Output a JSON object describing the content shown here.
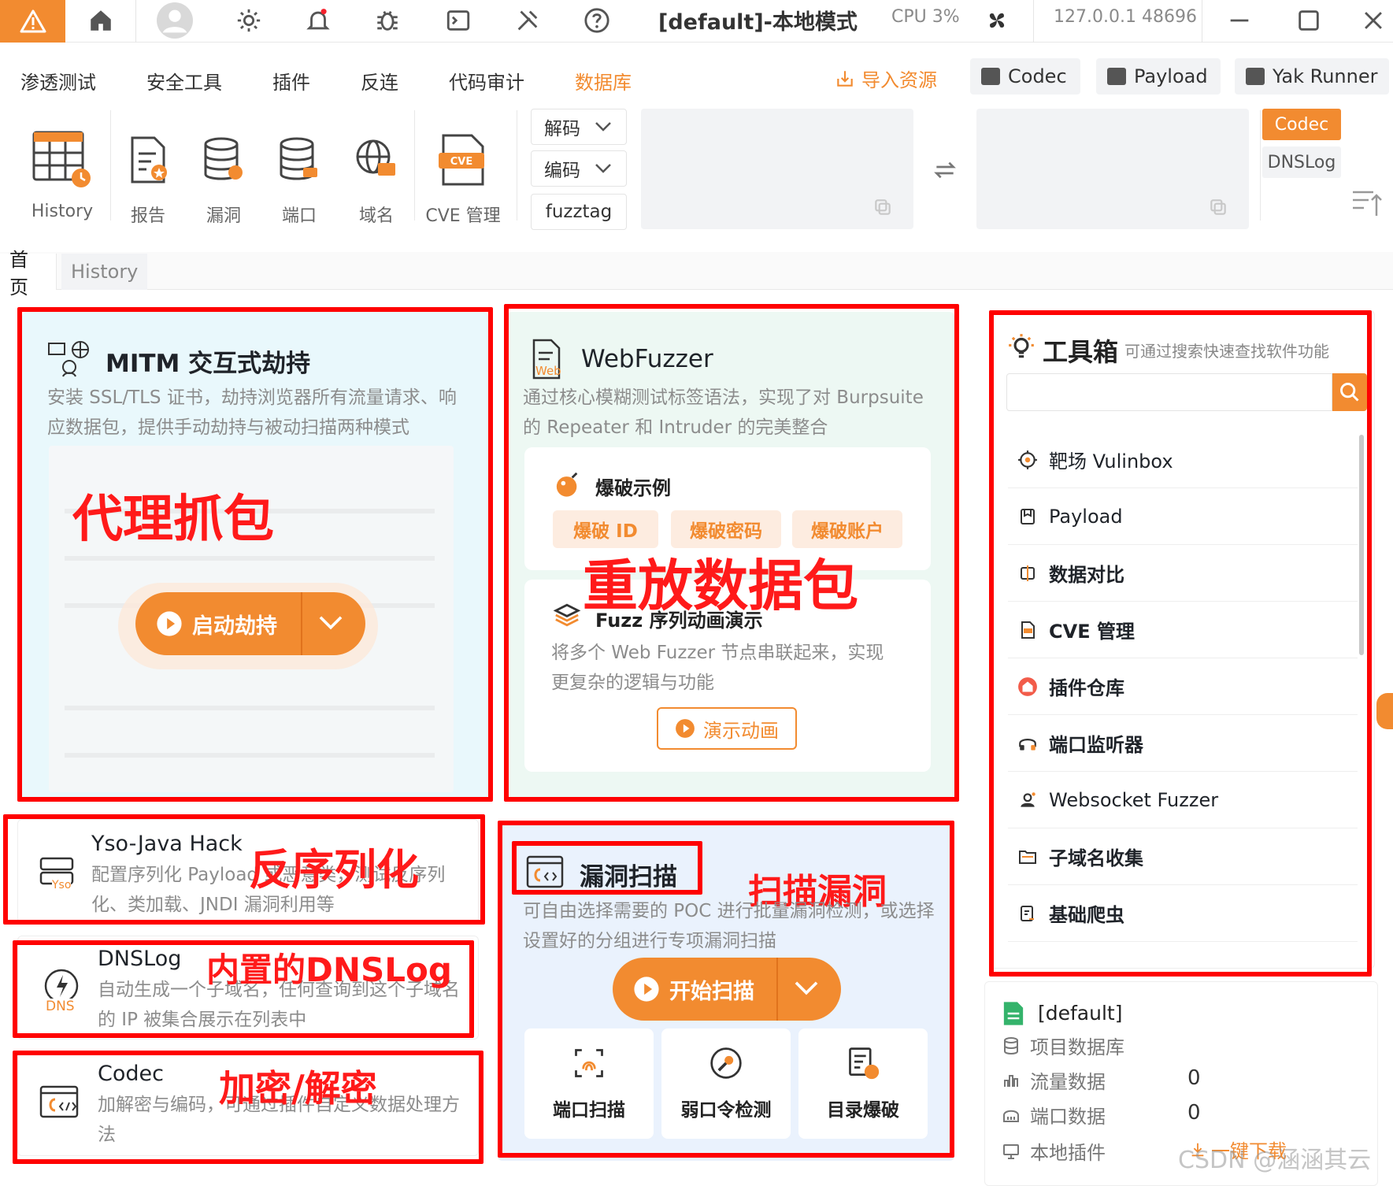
{
  "titlebar": {
    "mode_title": "[default]-本地模式",
    "cpu": "CPU 3%",
    "host": "127.0.0.1 48696",
    "icons": [
      "yak-logo",
      "home-icon",
      "user-avatar-icon",
      "settings-icon",
      "bell-icon",
      "bug-icon",
      "terminal-icon",
      "tools-icon",
      "help-icon",
      "engine-status-icon",
      "minimize-icon",
      "maximize-icon",
      "close-icon"
    ]
  },
  "menu": {
    "items": [
      "渗透测试",
      "安全工具",
      "插件",
      "反连",
      "代码审计",
      "数据库"
    ],
    "active": "数据库",
    "import_label": "导入资源",
    "buttons": [
      "Codec",
      "Payload",
      "Yak Runner"
    ]
  },
  "toolbar": {
    "tools": [
      "History",
      "报告",
      "漏洞",
      "端口",
      "域名",
      "CVE 管理"
    ],
    "decode_label": "解码",
    "encode_label": "编码",
    "fuzztag_label": "fuzztag",
    "side_tabs": [
      "Codec",
      "DNSLog"
    ]
  },
  "tabs": [
    "首页",
    "History"
  ],
  "mitm": {
    "title": "MITM 交互式劫持",
    "desc": "安装 SSL/TLS 证书，劫持浏览器所有流量请求、响应数据包，提供手动劫持与被动扫描两种模式",
    "start_label": "启动劫持"
  },
  "webfuzzer": {
    "title": "WebFuzzer",
    "icon_text": "Web",
    "desc": "通过核心模糊测试标签语法，实现了对 Burpsuite 的 Repeater 和 Intruder 的完美整合",
    "example_title": "爆破示例",
    "examples": [
      "爆破 ID",
      "爆破密码",
      "爆破账户"
    ],
    "seq_title": "Fuzz 序列动画演示",
    "seq_desc": "将多个 Web Fuzzer 节点串联起来，实现更复杂的逻辑与功能",
    "demo_label": "演示动画"
  },
  "toolbox": {
    "title": "工具箱",
    "subtitle": "可通过搜索快速查找软件功能",
    "search_placeholder": "",
    "items": [
      "靶场 Vulinbox",
      "Payload",
      "数据对比",
      "CVE 管理",
      "插件仓库",
      "端口监听器",
      "Websocket Fuzzer",
      "子域名收集",
      "基础爬虫"
    ]
  },
  "yso": {
    "title": "Yso-Java Hack",
    "icon_text": "Yso",
    "desc": "配置序列化 Payload 或恶意类，测试反序列化、类加载、JNDI 漏洞利用等"
  },
  "dnslog": {
    "title": "DNSLog",
    "icon_text": "DNS",
    "desc": "自动生成一个子域名，任何查询到这个子域名的 IP 被集合展示在列表中"
  },
  "codec": {
    "title": "Codec",
    "desc": "加解密与编码，可通过插件自定义数据处理方法"
  },
  "vulnscan": {
    "title": "漏洞扫描",
    "desc": "可自由选择需要的 POC 进行批量漏洞检测，或选择设置好的分组进行专项漏洞扫描",
    "start_label": "开始扫描",
    "sub": [
      "端口扫描",
      "弱口令检测",
      "目录爆破"
    ]
  },
  "project": {
    "name": "[default]",
    "rows": [
      {
        "label": "项目数据库",
        "value": ""
      },
      {
        "label": "流量数据",
        "value": "0"
      },
      {
        "label": "端口数据",
        "value": "0"
      },
      {
        "label": "本地插件",
        "value": ""
      }
    ],
    "download_label": "一键下载"
  },
  "annotations": {
    "proxy": "代理抓包",
    "replay": "重放数据包",
    "deserialize": "反序列化",
    "scan": "扫描漏洞",
    "dnslog": "内置的DNSLog",
    "crypto": "加密/解密"
  },
  "watermark": "CSDN @涵涵其云",
  "colors": {
    "accent": "#f28b30",
    "annotation": "#ff0000",
    "mitm_bg": "#e9f8fc",
    "fuzzer_bg": "#edf8f3",
    "scan_bg": "#eaf2fd"
  }
}
